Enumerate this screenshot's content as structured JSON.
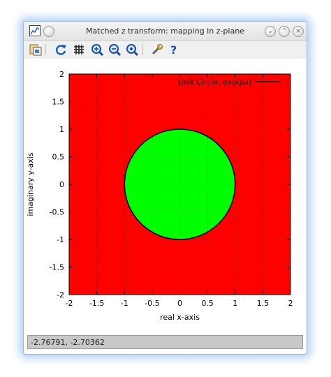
{
  "window": {
    "title": "Matched z transform: mapping in z-plane",
    "buttons": {
      "minimize": "⌄",
      "maximize": "⌃",
      "close": "×"
    }
  },
  "toolbar": {
    "items": [
      {
        "icon": "figure-icon"
      },
      {
        "icon": "rotate-icon"
      },
      {
        "icon": "grid-icon"
      },
      {
        "icon": "zoom-in-icon"
      },
      {
        "icon": "zoom-out-icon"
      },
      {
        "icon": "zoom-reset-icon"
      },
      {
        "icon": "settings-wrench-icon"
      },
      {
        "icon": "help-icon"
      }
    ]
  },
  "chart_data": {
    "type": "area",
    "xlabel": "real x-axis",
    "ylabel": "imaginary y-axis",
    "xlim": [
      -2,
      2
    ],
    "ylim": [
      -2,
      2
    ],
    "xticks": [
      "-2",
      "-1.5",
      "-1",
      "-0.5",
      "0",
      "0.5",
      "1",
      "1.5",
      "2"
    ],
    "yticks": [
      "-2",
      "-1.5",
      "-1",
      "-0.5",
      "0",
      "0.5",
      "1",
      "1.5",
      "2"
    ],
    "grid": true,
    "legend_position": "top-right",
    "background_region_color": "#ff0000",
    "series": [
      {
        "name": "Unit Circle, exp(jω)",
        "shape": "circle",
        "center": [
          0,
          0
        ],
        "radius": 1,
        "fill": "#00ff00",
        "line_color": "#000000"
      }
    ]
  },
  "status": {
    "coordinates": "-2.76791, -2.70362"
  }
}
